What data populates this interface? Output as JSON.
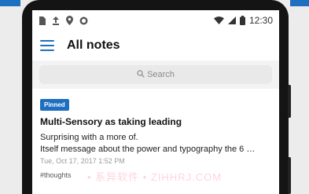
{
  "status_bar": {
    "time": "12:30",
    "left_icons": [
      "sim-card-icon",
      "upload-icon",
      "location-pin-icon",
      "sync-icon"
    ],
    "right_icons": [
      "wifi-icon",
      "signal-icon",
      "battery-icon"
    ]
  },
  "app_bar": {
    "title": "All notes",
    "menu_icon": "hamburger-menu-icon"
  },
  "search": {
    "placeholder": "Search",
    "icon": "search-icon"
  },
  "notes": [
    {
      "badge": "Pinned",
      "title": "Multi-Sensory as taking leading",
      "line1": "Surprising with a more of.",
      "line2": "Itself message about the power and typography the 6 …",
      "date": "Tue, Oct 17, 2017 1:52 PM",
      "tag": "#thoughts"
    }
  ],
  "watermark": "• 系异软件 • ZIHHRJ.COM",
  "colors": {
    "accent": "#1e6fc0",
    "frame": "#141414",
    "background": "#f3f3f3"
  }
}
